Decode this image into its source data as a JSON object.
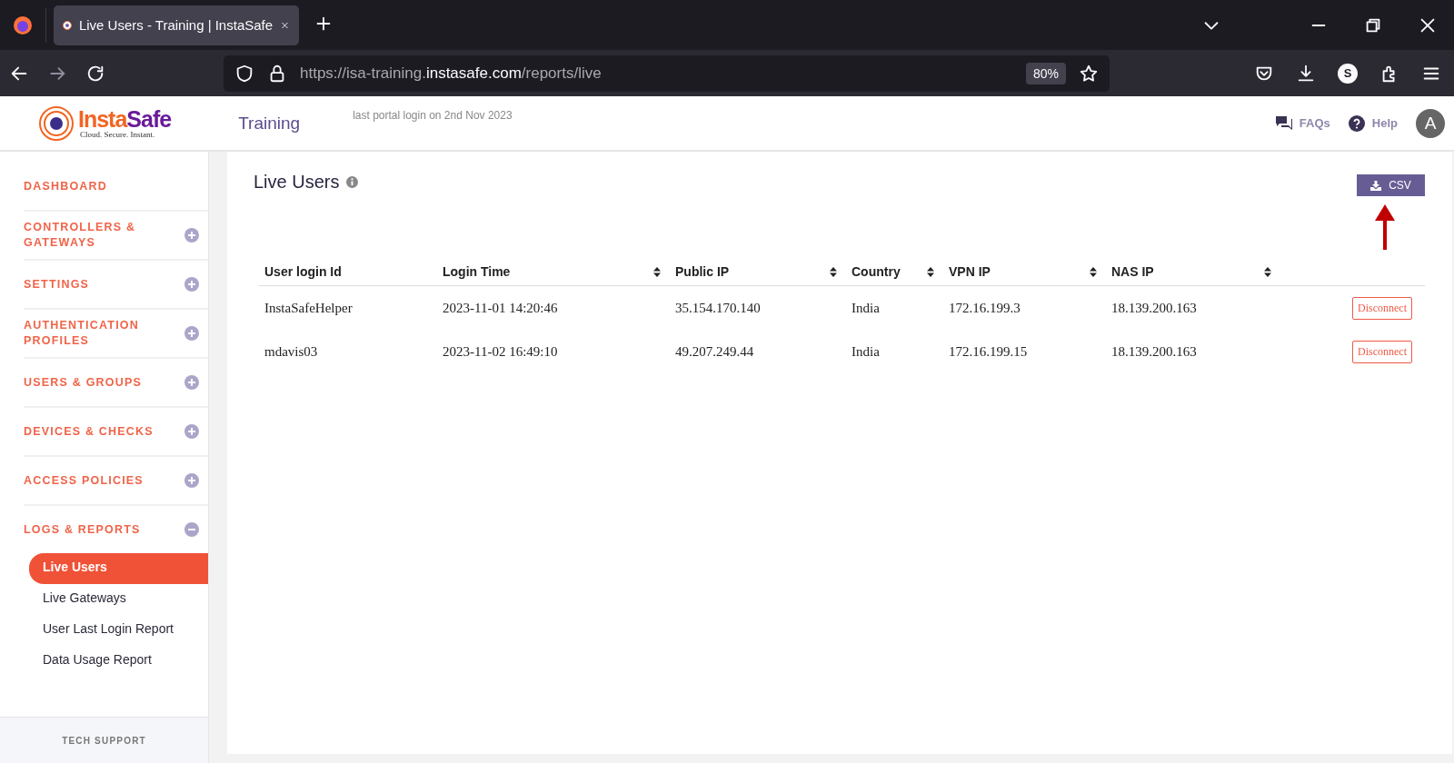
{
  "browser": {
    "tab_title": "Live Users - Training | InstaSafe",
    "url": {
      "prefix": "https://isa-training.",
      "domain": "instasafe.com",
      "path": "/reports/live"
    },
    "zoom": "80%",
    "profile_initial": "S"
  },
  "header": {
    "logo": {
      "wordmark": [
        "Insta",
        "Safe"
      ],
      "tagline": "Cloud. Secure. Instant."
    },
    "environment": "Training",
    "last_login": "last portal login on 2nd Nov 2023",
    "links": [
      "FAQs",
      "Help"
    ],
    "avatar": "A"
  },
  "sidebar": {
    "items": [
      {
        "label": "DASHBOARD",
        "kind": "link"
      },
      {
        "label": "CONTROLLERS & GATEWAYS",
        "kind": "group",
        "expanded": false
      },
      {
        "label": "SETTINGS",
        "kind": "group",
        "expanded": false
      },
      {
        "label": "AUTHENTICATION PROFILES",
        "kind": "group",
        "expanded": false
      },
      {
        "label": "USERS & GROUPS",
        "kind": "group",
        "expanded": false
      },
      {
        "label": "DEVICES & CHECKS",
        "kind": "group",
        "expanded": false
      },
      {
        "label": "ACCESS POLICIES",
        "kind": "group",
        "expanded": false
      },
      {
        "label": "LOGS & REPORTS",
        "kind": "group",
        "expanded": true,
        "children": [
          {
            "label": "Live Users",
            "selected": true
          },
          {
            "label": "Live Gateways",
            "selected": false
          },
          {
            "label": "User Last Login Report",
            "selected": false
          },
          {
            "label": "Data Usage Report",
            "selected": false
          }
        ]
      }
    ],
    "footer": "TECH SUPPORT"
  },
  "main": {
    "title": "Live Users",
    "export_button": "CSV",
    "table": {
      "columns": [
        {
          "label": "User login Id",
          "sortable": false
        },
        {
          "label": "Login Time",
          "sortable": true
        },
        {
          "label": "Public IP",
          "sortable": true
        },
        {
          "label": "Country",
          "sortable": true
        },
        {
          "label": "VPN IP",
          "sortable": true
        },
        {
          "label": "NAS IP",
          "sortable": true
        }
      ],
      "rows": [
        {
          "cells": [
            "InstaSafeHelper",
            "2023-11-01 14:20:46",
            "35.154.170.140",
            "India",
            "172.16.199.3",
            "18.139.200.163"
          ],
          "action": "Disconnect"
        },
        {
          "cells": [
            "mdavis03",
            "2023-11-02 16:49:10",
            "49.207.249.44",
            "India",
            "172.16.199.15",
            "18.139.200.163"
          ],
          "action": "Disconnect"
        }
      ]
    }
  }
}
